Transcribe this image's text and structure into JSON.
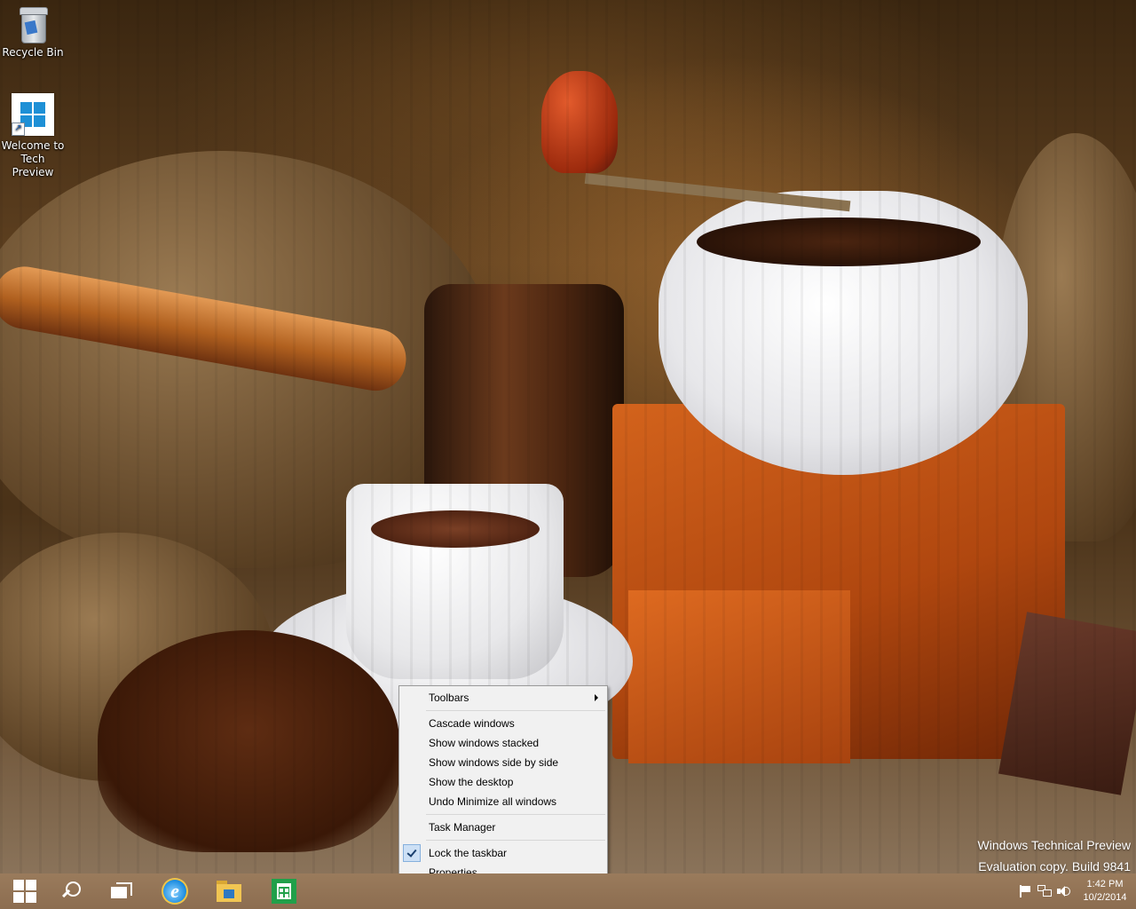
{
  "desktop": {
    "icons": [
      {
        "label": "Recycle Bin",
        "icon": "recycle-bin-icon"
      },
      {
        "label_line1": "Welcome to",
        "label_line2": "Tech Preview",
        "icon": "windows-shortcut-icon"
      }
    ],
    "watermark": {
      "line1": "Windows Technical Preview",
      "line2": "Evaluation copy. Build 9841"
    }
  },
  "context_menu": {
    "toolbars": "Toolbars",
    "cascade": "Cascade windows",
    "stacked": "Show windows stacked",
    "side_by_side": "Show windows side by side",
    "show_desktop": "Show the desktop",
    "undo_minimize": "Undo Minimize all windows",
    "task_manager": "Task Manager",
    "lock_taskbar": "Lock the taskbar",
    "lock_taskbar_checked": true,
    "properties": "Properties"
  },
  "taskbar": {
    "background_color": "#8c6d50",
    "buttons": [
      "start-icon",
      "search-icon",
      "task-view-icon",
      "internet-explorer-icon",
      "file-explorer-icon",
      "store-icon"
    ],
    "tray": {
      "icons": [
        "action-center-flag-icon",
        "network-icon",
        "volume-icon"
      ],
      "time": "1:42 PM",
      "date": "10/2/2014"
    }
  }
}
